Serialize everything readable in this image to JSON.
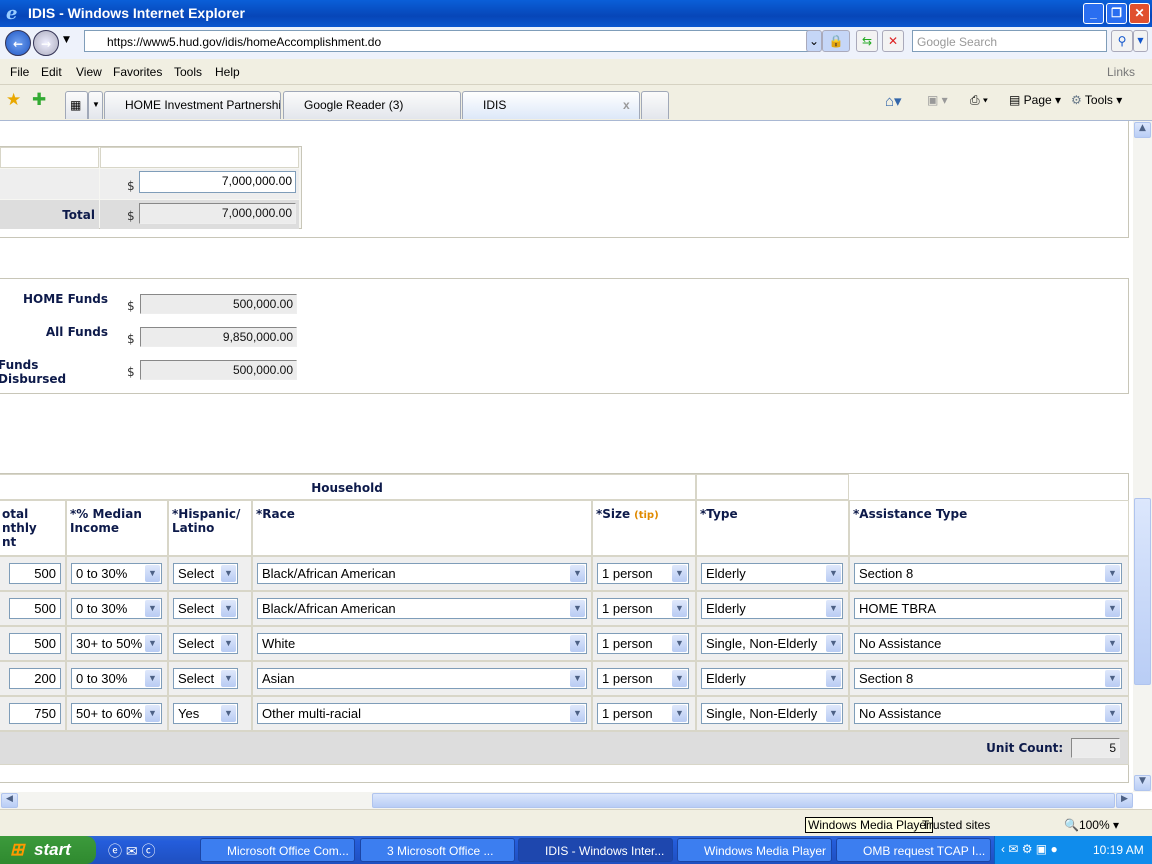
{
  "window": {
    "title": "IDIS - Windows Internet Explorer"
  },
  "address": {
    "url": "https://www5.hud.gov/idis/homeAccomplishment.do",
    "search_placeholder": "Google Search"
  },
  "menu": [
    "File",
    "Edit",
    "View",
    "Favorites",
    "Tools",
    "Help"
  ],
  "links_label": "Links",
  "tabs": [
    {
      "label": "HOME Investment Partnershi..."
    },
    {
      "label": "Google Reader (3)"
    },
    {
      "label": "IDIS"
    }
  ],
  "command_bar": {
    "page": "Page",
    "tools": "Tools"
  },
  "funding_table": {
    "amount": "7,000,000.00",
    "total_label": "Total",
    "total": "7,000,000.00",
    "currency": "$"
  },
  "funds": [
    {
      "label": "HOME Funds",
      "value": "500,000.00"
    },
    {
      "label": "All Funds",
      "value": "9,850,000.00"
    },
    {
      "label": "Funds Disbursed",
      "value": "500,000.00"
    }
  ],
  "household": {
    "group_header": "Household",
    "columns": [
      "otal\nnthly\nnt",
      "*% Median Income",
      "*Hispanic/ Latino",
      "*Race",
      "*Size",
      "*Type",
      "*Assistance Type"
    ],
    "tip": "(tip)",
    "rows": [
      {
        "rent": "500",
        "income": "0 to 30%",
        "hispanic": "Select",
        "race": "Black/African American",
        "size": "1 person",
        "type": "Elderly",
        "assistance": "Section 8"
      },
      {
        "rent": "500",
        "income": "0 to 30%",
        "hispanic": "Select",
        "race": "Black/African American",
        "size": "1 person",
        "type": "Elderly",
        "assistance": "HOME TBRA"
      },
      {
        "rent": "500",
        "income": "30+ to 50%",
        "hispanic": "Select",
        "race": "White",
        "size": "1 person",
        "type": "Single, Non-Elderly",
        "assistance": "No Assistance"
      },
      {
        "rent": "200",
        "income": "0 to 30%",
        "hispanic": "Select",
        "race": "Asian",
        "size": "1 person",
        "type": "Elderly",
        "assistance": "Section 8"
      },
      {
        "rent": "750",
        "income": "50+ to 60%",
        "hispanic": "Yes",
        "race": "Other multi-racial",
        "size": "1 person",
        "type": "Single, Non-Elderly",
        "assistance": "No Assistance"
      }
    ],
    "unit_count_label": "Unit Count:",
    "unit_count": "5"
  },
  "status": {
    "tooltip": "Windows Media Player",
    "zone": "Trusted sites",
    "zoom": "100%"
  },
  "taskbar": {
    "start": "start",
    "items": [
      "Microsoft Office Com...",
      "3 Microsoft Office ...",
      "IDIS - Windows Inter...",
      "Windows Media Player",
      "OMB request TCAP I..."
    ],
    "clock": "10:19 AM"
  },
  "colors": {
    "title_blue": "#0746b8",
    "label_navy": "#0d1a4a",
    "tip_orange": "#e08a00"
  }
}
